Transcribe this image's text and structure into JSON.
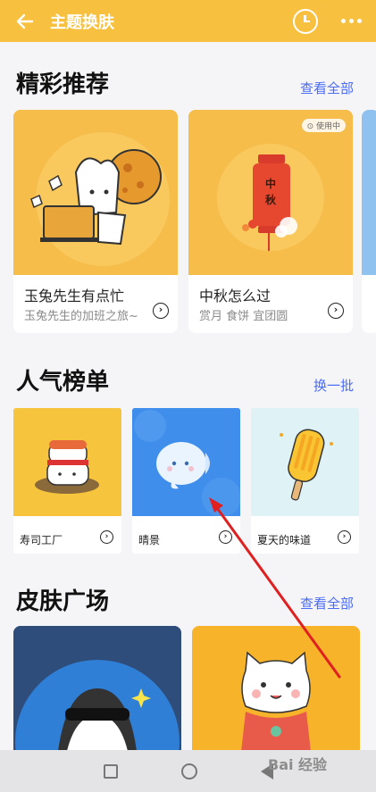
{
  "header": {
    "title": "主题换肤"
  },
  "featured": {
    "title": "精彩推荐",
    "link": "查看全部",
    "cards": [
      {
        "name": "玉兔先生有点忙",
        "desc": "玉兔先生的加班之旅~"
      },
      {
        "name": "中秋怎么过",
        "desc": "赏月 食饼 宜团圆",
        "badge": "使用中",
        "art_text": "中秋"
      }
    ]
  },
  "ranking": {
    "title": "人气榜单",
    "link": "换一批",
    "cards": [
      {
        "name": "寿司工厂"
      },
      {
        "name": "晴景"
      },
      {
        "name": "夏天的味道"
      }
    ]
  },
  "plaza": {
    "title": "皮肤广场",
    "link": "查看全部"
  },
  "watermark": "Bai 经验",
  "colors": {
    "topbar": "#f7c03f",
    "link": "#4a6cf7",
    "annotation_arrow": "#e02020"
  }
}
